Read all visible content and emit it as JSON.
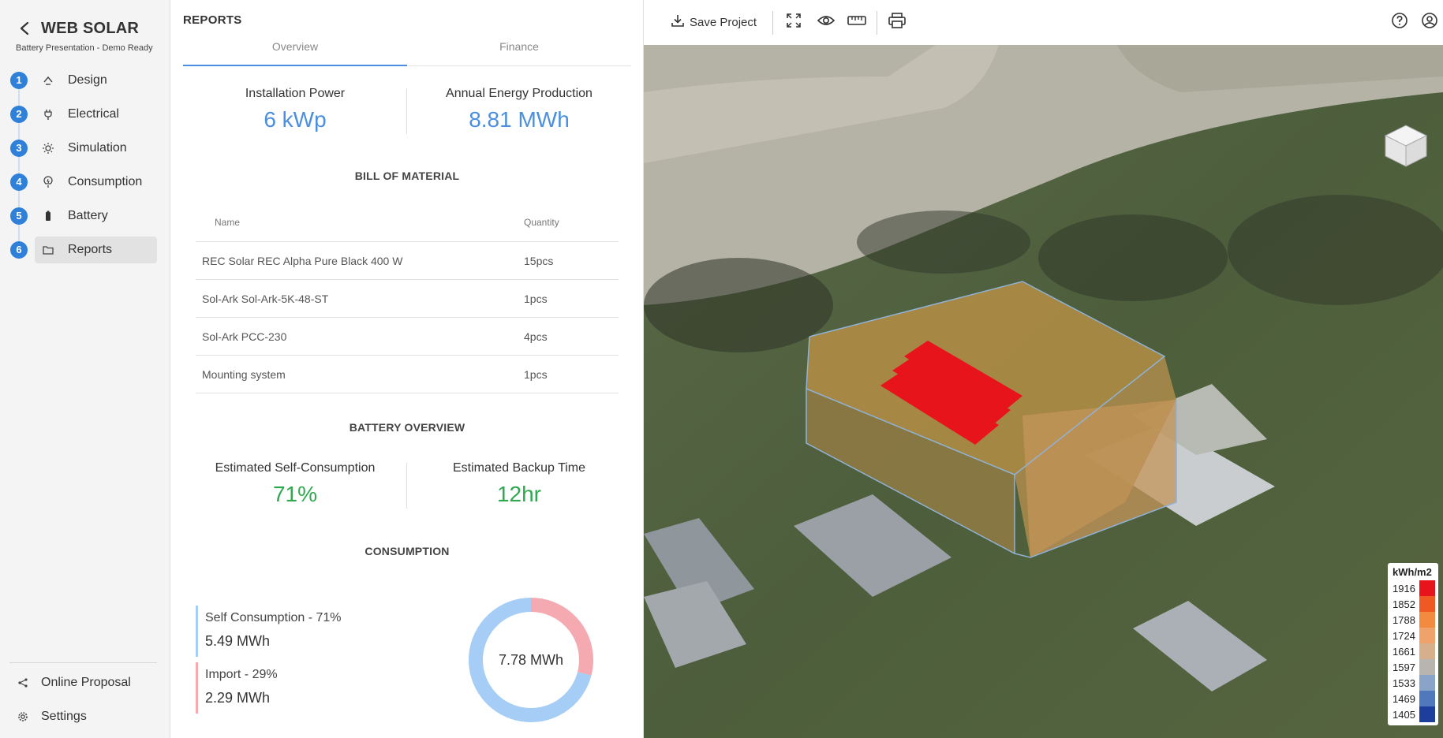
{
  "app": {
    "title": "WEB SOLAR",
    "subtitle": "Battery Presentation - Demo Ready"
  },
  "sidebar": {
    "steps": [
      {
        "num": "1",
        "label": "Design",
        "icon": "design-icon",
        "active": false
      },
      {
        "num": "2",
        "label": "Electrical",
        "icon": "plug-icon",
        "active": false
      },
      {
        "num": "3",
        "label": "Simulation",
        "icon": "sun-icon",
        "active": false
      },
      {
        "num": "4",
        "label": "Consumption",
        "icon": "consumption-icon",
        "active": false
      },
      {
        "num": "5",
        "label": "Battery",
        "icon": "battery-icon",
        "active": false
      },
      {
        "num": "6",
        "label": "Reports",
        "icon": "folder-icon",
        "active": true
      }
    ],
    "bottom": [
      {
        "label": "Online Proposal",
        "icon": "share-icon"
      },
      {
        "label": "Settings",
        "icon": "gear-icon"
      }
    ],
    "step_color": "#2f80d9"
  },
  "reports": {
    "title": "REPORTS",
    "tabs": [
      {
        "label": "Overview",
        "active": true
      },
      {
        "label": "Finance",
        "active": false
      }
    ],
    "kpis": {
      "installation_power": {
        "label": "Installation Power",
        "value": "6 kWp"
      },
      "annual_energy": {
        "label": "Annual Energy Production",
        "value": "8.81 MWh"
      }
    },
    "bom": {
      "title": "BILL OF MATERIAL",
      "headers": {
        "name": "Name",
        "quantity": "Quantity"
      },
      "rows": [
        {
          "name": "REC Solar REC Alpha Pure Black 400 W",
          "qty": "15pcs"
        },
        {
          "name": "Sol-Ark Sol-Ark-5K-48-ST",
          "qty": "1pcs"
        },
        {
          "name": "Sol-Ark PCC-230",
          "qty": "4pcs"
        },
        {
          "name": "Mounting system",
          "qty": "1pcs"
        }
      ]
    },
    "battery": {
      "title": "BATTERY OVERVIEW",
      "self_consumption": {
        "label": "Estimated Self-Consumption",
        "value": "71%"
      },
      "backup_time": {
        "label": "Estimated Backup Time",
        "value": "12hr"
      }
    },
    "consumption": {
      "title": "CONSUMPTION",
      "self": {
        "label": "Self Consumption - 71%",
        "value": "5.49 MWh",
        "fraction": 0.71,
        "color": "#a5cdf5"
      },
      "import": {
        "label": "Import - 29%",
        "value": "2.29 MWh",
        "fraction": 0.29,
        "color": "#f4aab0"
      },
      "total": "7.78 MWh"
    }
  },
  "viewer": {
    "toolbar": {
      "save_label": "Save Project",
      "icons": [
        "download-icon",
        "fullscreen-icon",
        "eye-icon",
        "ruler-icon",
        "print-icon",
        "help-icon",
        "account-icon"
      ]
    },
    "scale": {
      "title": "kWh/m2",
      "rows": [
        {
          "value": "1916",
          "color": "#e8141b"
        },
        {
          "value": "1852",
          "color": "#ee5a22"
        },
        {
          "value": "1788",
          "color": "#f28a3f"
        },
        {
          "value": "1724",
          "color": "#efa26a"
        },
        {
          "value": "1661",
          "color": "#d6b08a"
        },
        {
          "value": "1597",
          "color": "#b8b4b0"
        },
        {
          "value": "1533",
          "color": "#8aa3c9"
        },
        {
          "value": "1469",
          "color": "#4f78bd"
        },
        {
          "value": "1405",
          "color": "#1c3f9c"
        }
      ]
    }
  }
}
